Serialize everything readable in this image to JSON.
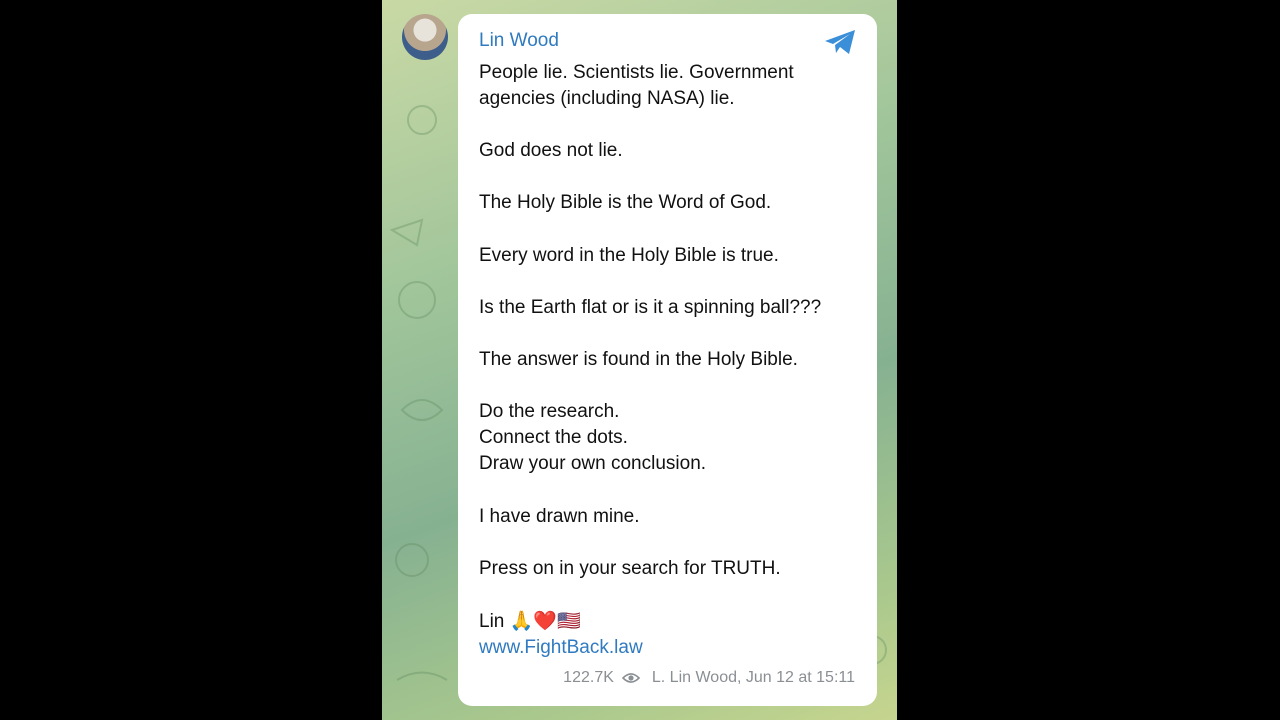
{
  "message": {
    "author": "Lin Wood",
    "body": "People lie. Scientists lie. Government agencies (including NASA) lie.\n\nGod does not lie.\n\nThe Holy Bible is the Word of God.\n\nEvery word in the Holy Bible is true.\n\nIs the Earth flat or is it a spinning ball???\n\nThe answer is found in the Holy Bible.\n\nDo the research.\nConnect the dots.\nDraw your own conclusion.\n\nI have drawn mine.\n\nPress on in your search for TRUTH.",
    "signature": "Lin 🙏❤️🇺🇸",
    "link": "www.FightBack.law",
    "views": "122.7K",
    "footer": "L. Lin Wood, Jun 12 at 15:11"
  },
  "icons": {
    "share": "telegram-send-icon",
    "views": "eye-icon"
  },
  "colors": {
    "accent": "#2f7ac0",
    "meta": "#8a8f94",
    "background_left": "#000000"
  }
}
